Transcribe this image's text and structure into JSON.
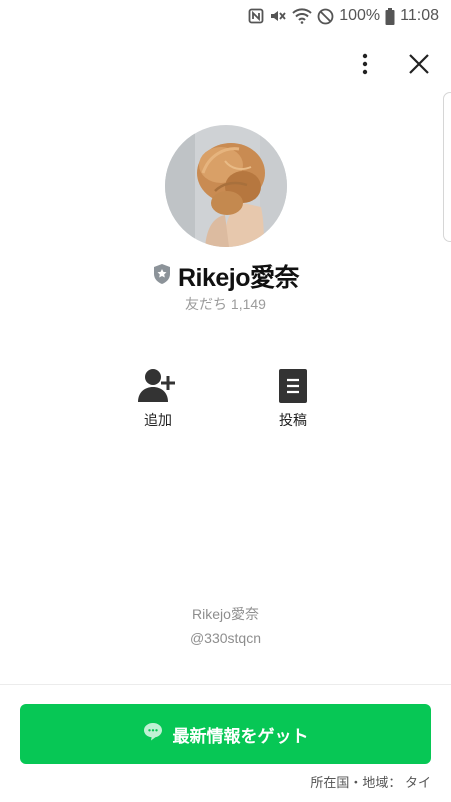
{
  "status_bar": {
    "battery_percent": "100%",
    "time": "11:08",
    "icons": [
      "nfc-icon",
      "mute-icon",
      "wifi-icon",
      "do-not-disturb-icon",
      "battery-icon"
    ]
  },
  "header": {
    "actions": [
      "more-options-icon",
      "close-icon"
    ]
  },
  "profile": {
    "name": "Rikejo愛奈",
    "friends_label": "友だち 1,149"
  },
  "actions": [
    {
      "label": "追加",
      "icon": "add-friend-icon"
    },
    {
      "label": "投稿",
      "icon": "posts-icon"
    }
  ],
  "footer": {
    "account_name": "Rikejo愛奈",
    "account_id": "@330stqcn"
  },
  "cta": {
    "label": "最新情報をゲット",
    "icon": "chat-bubble-icon"
  },
  "region_label": "所在国・地域： タイ",
  "colors": {
    "accent_green": "#07c755",
    "text_muted": "#9b9b9b"
  }
}
